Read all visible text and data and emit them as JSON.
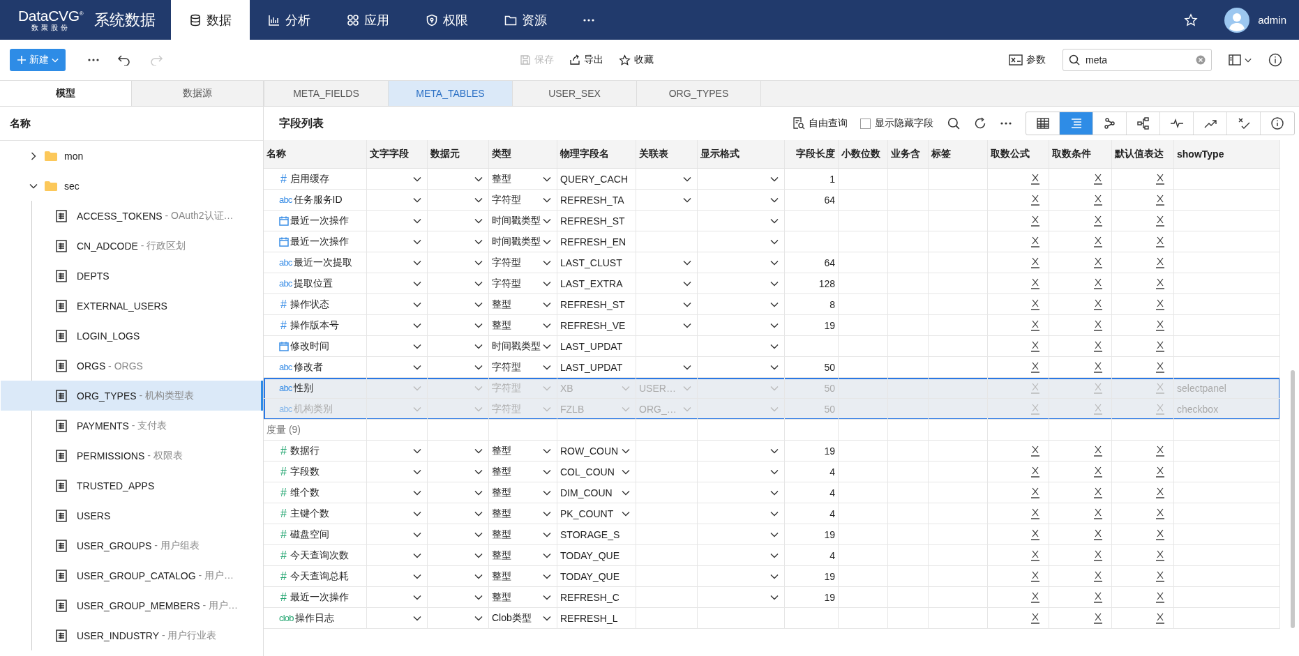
{
  "header": {
    "logo": "DataCVG",
    "logo_mark": "®",
    "logo_sub": "数聚股份",
    "app_title": "系统数据",
    "nav": [
      {
        "label": "数据",
        "selected": true
      },
      {
        "label": "分析",
        "selected": false
      },
      {
        "label": "应用",
        "selected": false
      },
      {
        "label": "权限",
        "selected": false
      },
      {
        "label": "资源",
        "selected": false
      }
    ],
    "user": "admin"
  },
  "toolbar": {
    "new_button": "新建",
    "save": {
      "label": "保存",
      "disabled": true
    },
    "export": "导出",
    "favorite": "收藏",
    "params": "参数",
    "search_value": "meta",
    "redo_disabled": true
  },
  "side_tabs": [
    {
      "label": "模型",
      "selected": true
    },
    {
      "label": "数据源",
      "selected": false
    }
  ],
  "doc_tabs": [
    {
      "label": "META_FIELDS",
      "selected": false
    },
    {
      "label": "META_TABLES",
      "selected": true
    },
    {
      "label": "USER_SEX",
      "selected": false
    },
    {
      "label": "ORG_TYPES",
      "selected": false
    }
  ],
  "sidebar": {
    "heading": "名称",
    "tree": [
      {
        "label": "mon",
        "expanded": false
      },
      {
        "label": "sec",
        "expanded": true,
        "children": [
          {
            "name": "ACCESS_TOKENS",
            "description": "- OAuth2认证…",
            "selected": false
          },
          {
            "name": "CN_ADCODE",
            "description": "- 行政区划",
            "selected": false
          },
          {
            "name": "DEPTS",
            "selected": false
          },
          {
            "name": "EXTERNAL_USERS",
            "selected": false
          },
          {
            "name": "LOGIN_LOGS",
            "selected": false
          },
          {
            "name": "ORGS",
            "description": "- ORGS",
            "selected": false
          },
          {
            "name": "ORG_TYPES",
            "description": "- 机构类型表",
            "selected": true
          },
          {
            "name": "PAYMENTS",
            "description": "- 支付表",
            "selected": false
          },
          {
            "name": "PERMISSIONS",
            "description": "- 权限表",
            "selected": false
          },
          {
            "name": "TRUSTED_APPS",
            "selected": false
          },
          {
            "name": "USERS",
            "selected": false
          },
          {
            "name": "USER_GROUPS",
            "description": "- 用户组表",
            "selected": false
          },
          {
            "name": "USER_GROUP_CATALOG",
            "description": "- 用户…",
            "selected": false
          },
          {
            "name": "USER_GROUP_MEMBERS",
            "description": "- 用户…",
            "selected": false
          },
          {
            "name": "USER_INDUSTRY",
            "description": "- 用户行业表",
            "selected": false
          }
        ]
      }
    ]
  },
  "fields": {
    "title": "字段列表",
    "free_query": "自由查询",
    "show_hidden": {
      "label": "显示隐藏字段",
      "checked": false
    },
    "views": [
      {
        "selected": false
      },
      {
        "selected": true
      },
      {
        "selected": false
      },
      {
        "selected": false
      },
      {
        "selected": false
      },
      {
        "selected": false
      },
      {
        "selected": false
      },
      {
        "selected": false
      }
    ],
    "columns": [
      "名称",
      "文字字段",
      "数据元",
      "类型",
      "物理字段名",
      "关联表",
      "显示格式",
      "字段长度",
      "小数位数",
      "业务含",
      "标签",
      "取数公式",
      "取数条件",
      "默认值表达",
      "showType"
    ],
    "groups": [
      {
        "kind": "dimension",
        "rows": [
          {
            "kind": "number",
            "icon": "#",
            "name": "启用缓存",
            "type": "整型",
            "physical": "QUERY_CACH",
            "physical_dropdown": false,
            "relation_dropdown": true,
            "format_dropdown": true,
            "length": "1",
            "selected": false,
            "dimmed": false
          },
          {
            "kind": "text",
            "icon": "abc",
            "name": "任务服务ID",
            "type": "字符型",
            "physical": "REFRESH_TA",
            "physical_dropdown": false,
            "relation_dropdown": true,
            "format_dropdown": true,
            "length": "64",
            "selected": false,
            "dimmed": false
          },
          {
            "kind": "date",
            "name": "最近一次操作",
            "type": "时间戳类型",
            "physical": "REFRESH_ST",
            "physical_dropdown": false,
            "relation_dropdown": false,
            "format_dropdown": true,
            "selected": false,
            "dimmed": false
          },
          {
            "kind": "date",
            "name": "最近一次操作",
            "type": "时间戳类型",
            "physical": "REFRESH_EN",
            "physical_dropdown": false,
            "relation_dropdown": false,
            "format_dropdown": true,
            "selected": false,
            "dimmed": false
          },
          {
            "kind": "text",
            "icon": "abc",
            "name": "最近一次提取",
            "type": "字符型",
            "physical": "LAST_CLUST",
            "physical_dropdown": false,
            "relation_dropdown": true,
            "format_dropdown": true,
            "length": "64",
            "selected": false,
            "dimmed": false
          },
          {
            "kind": "text",
            "icon": "abc",
            "name": "提取位置",
            "type": "字符型",
            "physical": "LAST_EXTRA",
            "physical_dropdown": false,
            "relation_dropdown": true,
            "format_dropdown": true,
            "length": "128",
            "selected": false,
            "dimmed": false
          },
          {
            "kind": "number",
            "icon": "#",
            "name": "操作状态",
            "type": "整型",
            "physical": "REFRESH_ST",
            "physical_dropdown": false,
            "relation_dropdown": true,
            "format_dropdown": true,
            "length": "8",
            "selected": false,
            "dimmed": false
          },
          {
            "kind": "number",
            "icon": "#",
            "name": "操作版本号",
            "type": "整型",
            "physical": "REFRESH_VE",
            "physical_dropdown": false,
            "relation_dropdown": true,
            "format_dropdown": true,
            "length": "19",
            "selected": false,
            "dimmed": false
          },
          {
            "kind": "date",
            "name": "修改时间",
            "type": "时间戳类型",
            "physical": "LAST_UPDAT",
            "physical_dropdown": false,
            "relation_dropdown": false,
            "format_dropdown": true,
            "selected": false,
            "dimmed": false
          },
          {
            "kind": "text",
            "icon": "abc",
            "name": "修改者",
            "type": "字符型",
            "physical": "LAST_UPDAT",
            "physical_dropdown": false,
            "relation_dropdown": true,
            "format_dropdown": true,
            "length": "50",
            "selected": false,
            "dimmed": false
          },
          {
            "kind": "text",
            "icon": "abc",
            "name": "性别",
            "type": "字符型",
            "physical": "XB",
            "physical_dropdown": true,
            "relation": "USER…",
            "relation_dropdown": true,
            "format_dropdown": true,
            "length": "50",
            "show_type": "selectpanel",
            "selected": true,
            "dimmed": false
          },
          {
            "kind": "text",
            "icon": "abc",
            "name": "机构类别",
            "type": "字符型",
            "physical": "FZLB",
            "physical_dropdown": true,
            "relation": "ORG_…",
            "relation_dropdown": true,
            "format_dropdown": true,
            "length": "50",
            "show_type": "checkbox",
            "selected": true,
            "dimmed": true
          }
        ]
      },
      {
        "kind": "measure",
        "label": "度量 (9)",
        "rows": [
          {
            "kind": "number",
            "icon": "#",
            "name": "数据行",
            "type": "整型",
            "physical": "ROW_COUN",
            "physical_dropdown": true,
            "relation_dropdown": false,
            "format_dropdown": true,
            "length": "19",
            "selected": false,
            "dimmed": false
          },
          {
            "kind": "number",
            "icon": "#",
            "name": "字段数",
            "type": "整型",
            "physical": "COL_COUN",
            "physical_dropdown": true,
            "relation_dropdown": false,
            "format_dropdown": true,
            "length": "4",
            "selected": false,
            "dimmed": false
          },
          {
            "kind": "number",
            "icon": "#",
            "name": "维个数",
            "type": "整型",
            "physical": "DIM_COUN",
            "physical_dropdown": true,
            "relation_dropdown": false,
            "format_dropdown": true,
            "length": "4",
            "selected": false,
            "dimmed": false
          },
          {
            "kind": "number",
            "icon": "#",
            "name": "主键个数",
            "type": "整型",
            "physical": "PK_COUNT",
            "physical_dropdown": true,
            "relation_dropdown": false,
            "format_dropdown": true,
            "length": "4",
            "selected": false,
            "dimmed": false
          },
          {
            "kind": "number",
            "icon": "#",
            "name": "磁盘空间",
            "type": "整型",
            "physical": "STORAGE_S",
            "physical_dropdown": false,
            "relation_dropdown": false,
            "format_dropdown": true,
            "length": "19",
            "selected": false,
            "dimmed": false
          },
          {
            "kind": "number",
            "icon": "#",
            "name": "今天查询次数",
            "type": "整型",
            "physical": "TODAY_QUE",
            "physical_dropdown": false,
            "relation_dropdown": false,
            "format_dropdown": true,
            "length": "4",
            "selected": false,
            "dimmed": false
          },
          {
            "kind": "number",
            "icon": "#",
            "name": "今天查询总耗",
            "type": "整型",
            "physical": "TODAY_QUE",
            "physical_dropdown": false,
            "relation_dropdown": false,
            "format_dropdown": true,
            "length": "19",
            "selected": false,
            "dimmed": false
          },
          {
            "kind": "number",
            "icon": "#",
            "name": "最近一次操作",
            "type": "整型",
            "physical": "REFRESH_C",
            "physical_dropdown": false,
            "relation_dropdown": false,
            "format_dropdown": true,
            "length": "19",
            "selected": false,
            "dimmed": false
          },
          {
            "kind": "clob",
            "icon": "clob",
            "name": "操作日志",
            "type": "Clob类型",
            "physical": "REFRESH_L",
            "physical_dropdown": false,
            "relation_dropdown": false,
            "format_dropdown": false,
            "selected": false,
            "dimmed": false
          }
        ]
      }
    ]
  }
}
